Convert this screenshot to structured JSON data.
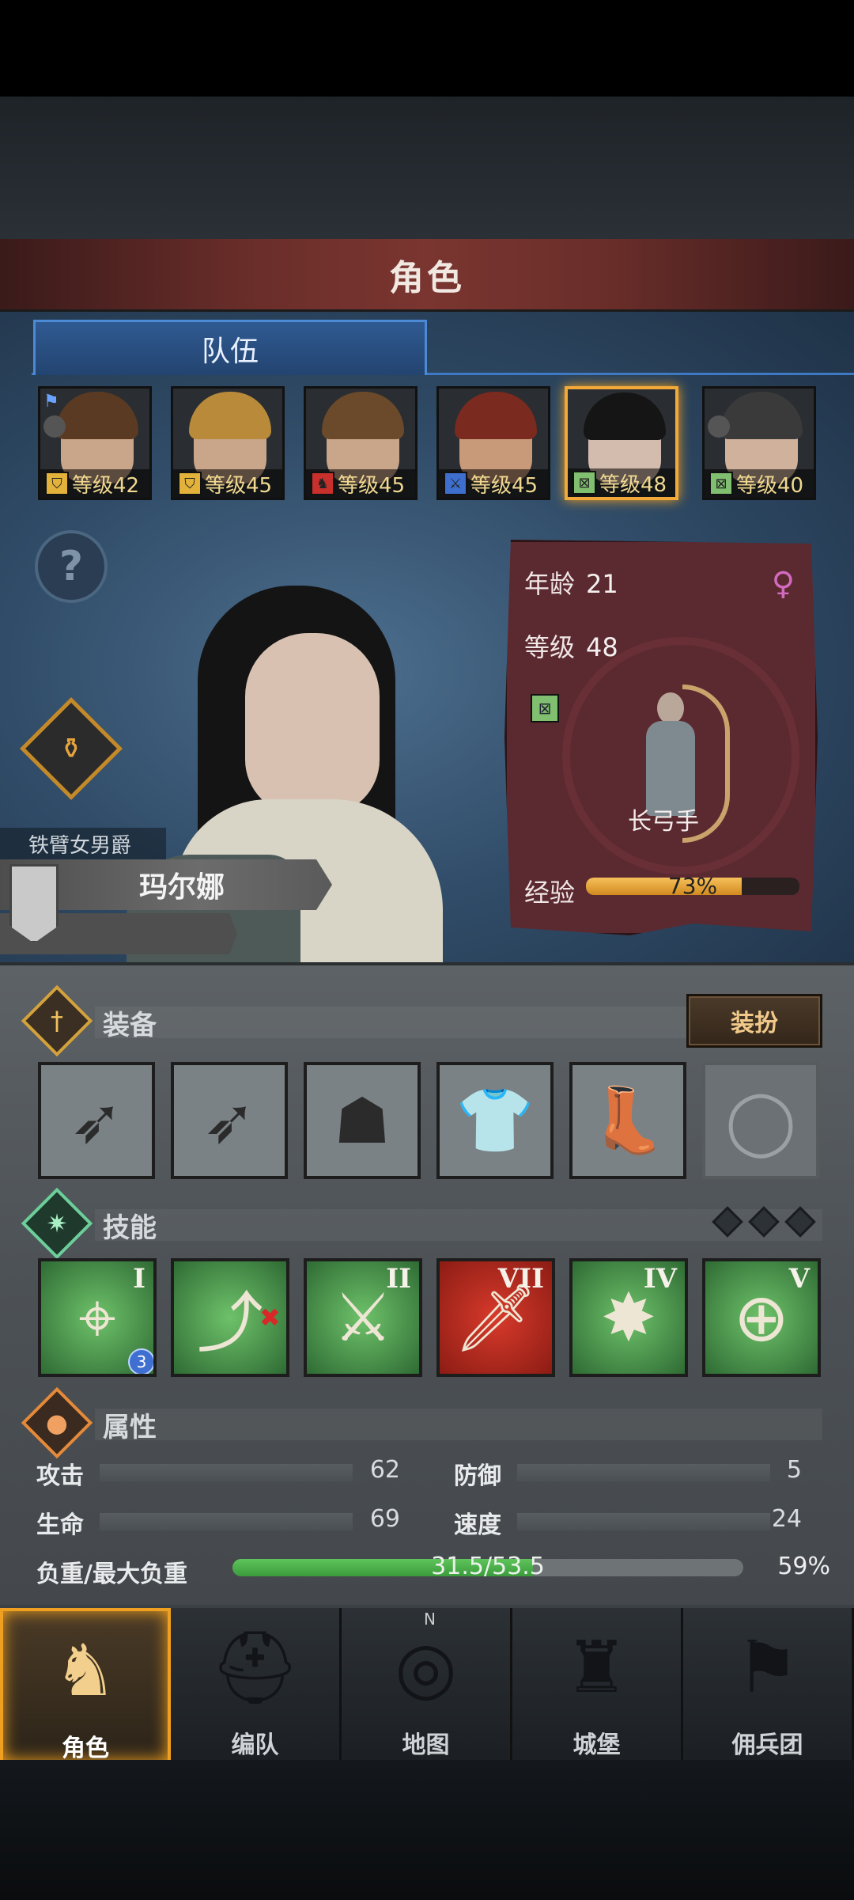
{
  "header": {
    "title": "角色"
  },
  "tabs": [
    {
      "label": "队伍"
    }
  ],
  "team": [
    {
      "level_text": "等级42",
      "class_icon": "shield-icon",
      "class_color": "#e2b23a",
      "skin": "#c9a58a",
      "hair": "#5a3a22",
      "flag": true,
      "group": true,
      "selected": false
    },
    {
      "level_text": "等级45",
      "class_icon": "shield-icon",
      "class_color": "#e2b23a",
      "skin": "#c9a58a",
      "hair": "#b88a3a",
      "flag": false,
      "group": false,
      "selected": false
    },
    {
      "level_text": "等级45",
      "class_icon": "horse-icon",
      "class_color": "#c8302c",
      "skin": "#c9a58a",
      "hair": "#6a4a2a",
      "flag": false,
      "group": false,
      "selected": false
    },
    {
      "level_text": "等级45",
      "class_icon": "sword-icon",
      "class_color": "#3e6fcf",
      "skin": "#c89a7a",
      "hair": "#7a2a1e",
      "flag": false,
      "group": false,
      "selected": false
    },
    {
      "level_text": "等级48",
      "class_icon": "bow-icon",
      "class_color": "#7fbf6f",
      "skin": "#d3bcae",
      "hair": "#151515",
      "flag": false,
      "group": false,
      "selected": true
    },
    {
      "level_text": "等级40",
      "class_icon": "bow-icon",
      "class_color": "#7fbf6f",
      "skin": "#cfb19c",
      "hair": "#3a3a3a",
      "flag": false,
      "group": true,
      "selected": false
    }
  ],
  "character": {
    "title": "铁臂女男爵",
    "name": "玛尔娜"
  },
  "info": {
    "age_label": "年龄",
    "age": "21",
    "level_label": "等级",
    "level": "48",
    "gender_icon": "female-icon",
    "class_name": "长弓手",
    "exp_label": "经验",
    "exp_percent": 73,
    "exp_text": "73%"
  },
  "equipment": {
    "label": "装备",
    "dress_label": "装扮",
    "slots": [
      {
        "icon": "longbow-icon",
        "glyph": "➶"
      },
      {
        "icon": "longbow-icon",
        "glyph": "➶"
      },
      {
        "icon": "hood-icon",
        "glyph": "☗"
      },
      {
        "icon": "fur-coat-icon",
        "glyph": "👕"
      },
      {
        "icon": "boots-icon",
        "glyph": "👢"
      },
      {
        "icon": "ring-slot-icon",
        "glyph": "◯",
        "empty": true
      }
    ]
  },
  "skills": {
    "label": "技能",
    "items": [
      {
        "icon": "aimed-shot-icon",
        "glyph": "⌖",
        "numeral": "I",
        "badge": "3"
      },
      {
        "icon": "trample-icon",
        "glyph": "⤴",
        "numeral": "",
        "redx": true
      },
      {
        "icon": "arrow-sword-icon",
        "glyph": "⚔",
        "numeral": "II"
      },
      {
        "icon": "sword-strike-icon",
        "glyph": "🗡",
        "numeral": "VII",
        "red": true
      },
      {
        "icon": "burst-icon",
        "glyph": "✸",
        "numeral": "IV"
      },
      {
        "icon": "crosshair-icon",
        "glyph": "⊕",
        "numeral": "V"
      }
    ]
  },
  "attributes": {
    "label": "属性",
    "attack_label": "攻击",
    "attack": "62",
    "defense_label": "防御",
    "defense": "5",
    "hp_label": "生命",
    "hp": "69",
    "speed_label": "速度",
    "speed": "24",
    "weight_label": "负重/最大负重",
    "weight_text": "31.5/53.5",
    "weight_fraction": 0.589,
    "weight_pct": "59%"
  },
  "nav": [
    {
      "label": "角色",
      "icon": "knight-icon",
      "glyph": "♞",
      "active": true
    },
    {
      "label": "编队",
      "icon": "helmet-icon",
      "glyph": "⛑",
      "active": false
    },
    {
      "label": "地图",
      "icon": "compass-icon",
      "glyph": "◎",
      "active": false
    },
    {
      "label": "城堡",
      "icon": "castle-icon",
      "glyph": "♜",
      "active": false
    },
    {
      "label": "佣兵团",
      "icon": "mercenary-icon",
      "glyph": "⚑",
      "active": false
    }
  ],
  "compass_n": "N"
}
